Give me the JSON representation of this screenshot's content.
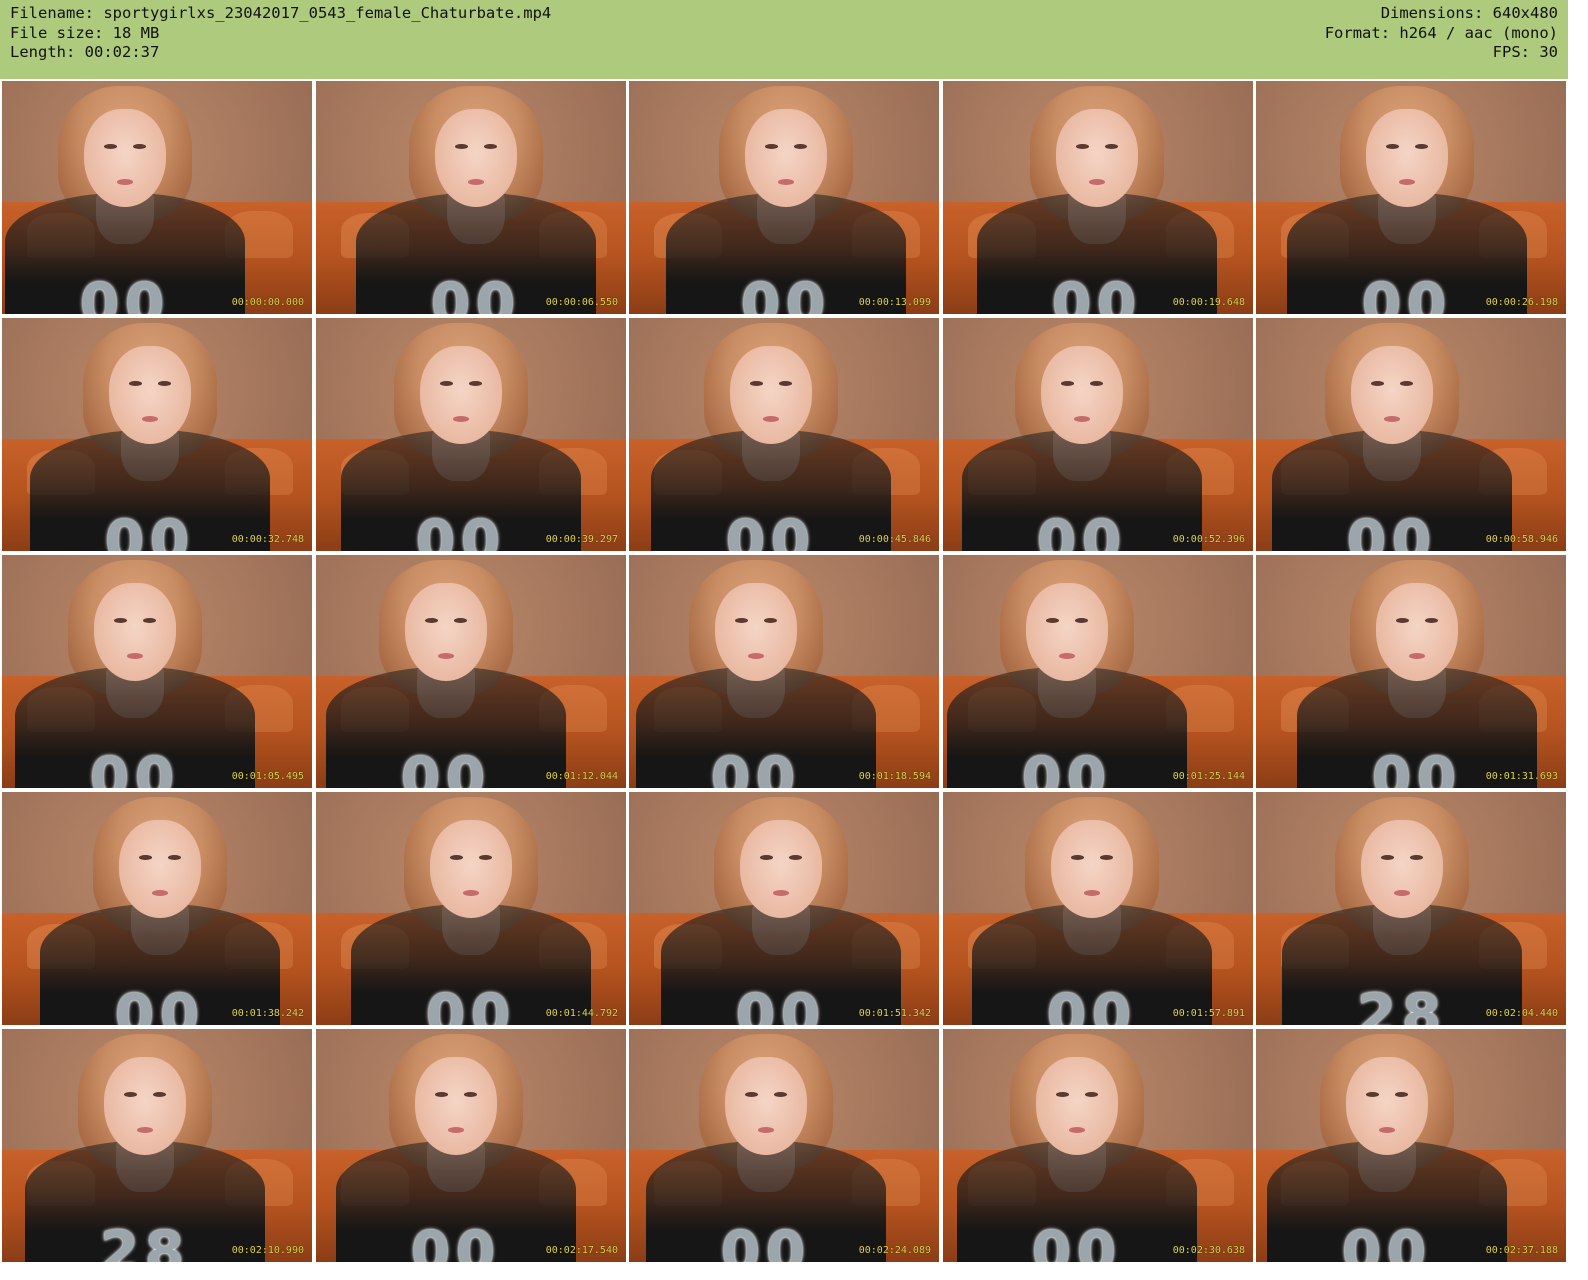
{
  "header": {
    "filename": "Filename: sportygirlxs_23042017_0543_female_Chaturbate.mp4",
    "file_size": "File size: 18 MB",
    "length": "Length: 00:02:37",
    "dimensions": "Dimensions: 640x480",
    "format": "Format: h264 / aac (mono)",
    "fps": "FPS: 30"
  },
  "colors": {
    "header_bg": "#aecb7d",
    "timestamp": "#e4d84a"
  },
  "thumbnails": [
    {
      "timestamp": "00:00:00.000"
    },
    {
      "timestamp": "00:00:06.550"
    },
    {
      "timestamp": "00:00:13.099"
    },
    {
      "timestamp": "00:00:19.648"
    },
    {
      "timestamp": "00:00:26.198"
    },
    {
      "timestamp": "00:00:32.748"
    },
    {
      "timestamp": "00:00:39.297"
    },
    {
      "timestamp": "00:00:45.846"
    },
    {
      "timestamp": "00:00:52.396"
    },
    {
      "timestamp": "00:00:58.946"
    },
    {
      "timestamp": "00:01:05.495"
    },
    {
      "timestamp": "00:01:12.044"
    },
    {
      "timestamp": "00:01:18.594"
    },
    {
      "timestamp": "00:01:25.144"
    },
    {
      "timestamp": "00:01:31.693"
    },
    {
      "timestamp": "00:01:38.242"
    },
    {
      "timestamp": "00:01:44.792"
    },
    {
      "timestamp": "00:01:51.342"
    },
    {
      "timestamp": "00:01:57.891"
    },
    {
      "timestamp": "00:02:04.440"
    },
    {
      "timestamp": "00:02:10.990"
    },
    {
      "timestamp": "00:02:17.540"
    },
    {
      "timestamp": "00:02:24.089"
    },
    {
      "timestamp": "00:02:30.638"
    },
    {
      "timestamp": "00:02:37.188"
    }
  ]
}
